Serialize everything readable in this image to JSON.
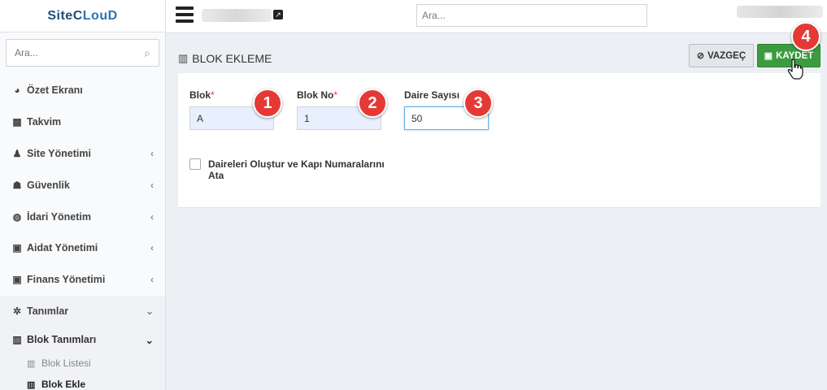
{
  "sidebar": {
    "logo": {
      "part1": "SiteC",
      "part2": "LouD"
    },
    "search_placeholder": "Ara...",
    "items": [
      {
        "label": "Özet Ekranı",
        "icon": "dashboard-icon",
        "glyph": "◕",
        "chevron": ""
      },
      {
        "label": "Takvim",
        "icon": "calendar-icon",
        "glyph": "▦",
        "chevron": ""
      },
      {
        "label": "Site Yönetimi",
        "icon": "users-icon",
        "glyph": "♟",
        "chevron": "‹"
      },
      {
        "label": "Güvenlik",
        "icon": "security-guard-icon",
        "glyph": "☗",
        "chevron": "‹"
      },
      {
        "label": "İdari Yönetim",
        "icon": "globe-icon",
        "glyph": "◍",
        "chevron": "‹"
      },
      {
        "label": "Aidat Yönetimi",
        "icon": "money-icon",
        "glyph": "▣",
        "chevron": "‹"
      },
      {
        "label": "Finans Yönetimi",
        "icon": "money-icon",
        "glyph": "▣",
        "chevron": "‹"
      }
    ],
    "open_item": {
      "label": "Tanımlar",
      "glyph": "✲",
      "chevron": "⌄"
    },
    "sub_group": {
      "label": "Blok Tanımları",
      "glyph": "▥",
      "chevron": "⌄"
    },
    "sub_items": [
      {
        "label": "Blok Listesi",
        "glyph": "▥",
        "active": false
      },
      {
        "label": "Blok Ekle",
        "glyph": "▥",
        "active": true
      }
    ]
  },
  "topbar": {
    "search_placeholder": "Ara..."
  },
  "page": {
    "title": "BLOK EKLEME",
    "cancel_label": "VAZGEÇ",
    "save_label": "KAYDET"
  },
  "form": {
    "blok": {
      "label": "Blok",
      "required": "*",
      "value": "A"
    },
    "blok_no": {
      "label": "Blok No",
      "required": "*",
      "value": "1"
    },
    "daire_sayisi": {
      "label": "Daire Sayısı",
      "value": "50"
    },
    "checkbox_label": "Daireleri Oluştur ve Kapı Numaralarını Ata"
  },
  "badges": [
    "1",
    "2",
    "3",
    "4"
  ],
  "colors": {
    "accent_save": "#3d9b3f",
    "badge": "#e53935",
    "required": "#ee3333"
  }
}
